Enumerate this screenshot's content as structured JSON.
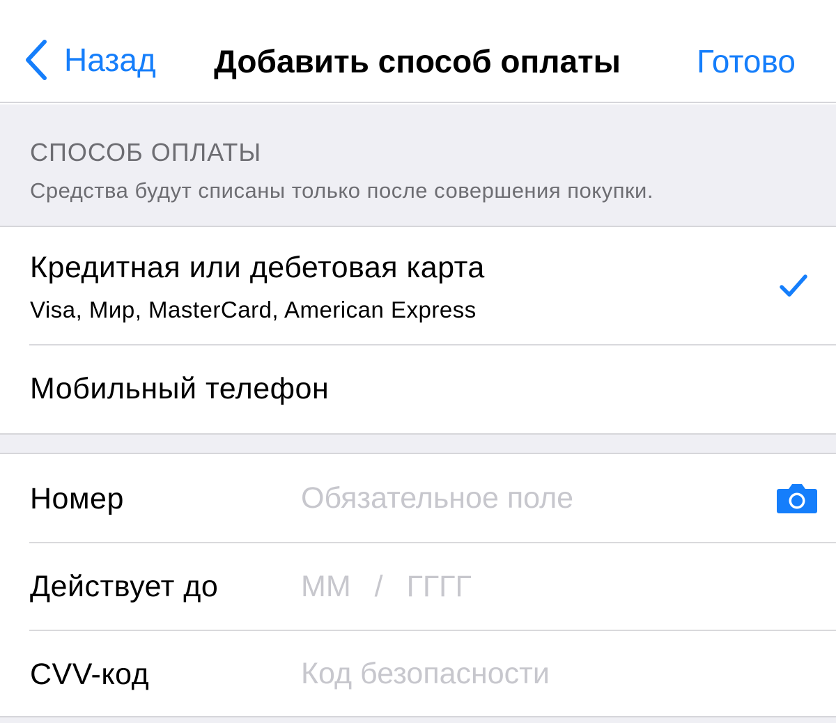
{
  "colors": {
    "accent": "#157efb",
    "background_grouped": "#efeff4",
    "separator": "#d9d9dc",
    "secondary_text": "#6d6d72",
    "placeholder": "#c7c7cd"
  },
  "nav": {
    "back_icon": "chevron-left-icon",
    "back_label": "Назад",
    "title": "Добавить способ оплаты",
    "done_label": "Готово"
  },
  "section": {
    "title": "СПОСОБ ОПЛАТЫ",
    "note": "Средства будут списаны только после совершения покупки."
  },
  "payment_methods": [
    {
      "title": "Кредитная или дебетовая карта",
      "subtitle": "Visa, Мир, MasterCard, American Express",
      "selected": true,
      "icon": "checkmark-icon"
    },
    {
      "title": "Мобильный телефон",
      "selected": false
    }
  ],
  "form": {
    "number": {
      "label": "Номер",
      "placeholder": "Обязательное поле",
      "value": "",
      "icon": "camera-icon"
    },
    "expiry": {
      "label": "Действует до",
      "month_placeholder": "ММ",
      "separator": "/",
      "year_placeholder": "ГГГГ"
    },
    "cvv": {
      "label": "CVV-код",
      "placeholder": "Код безопасности",
      "value": ""
    }
  }
}
